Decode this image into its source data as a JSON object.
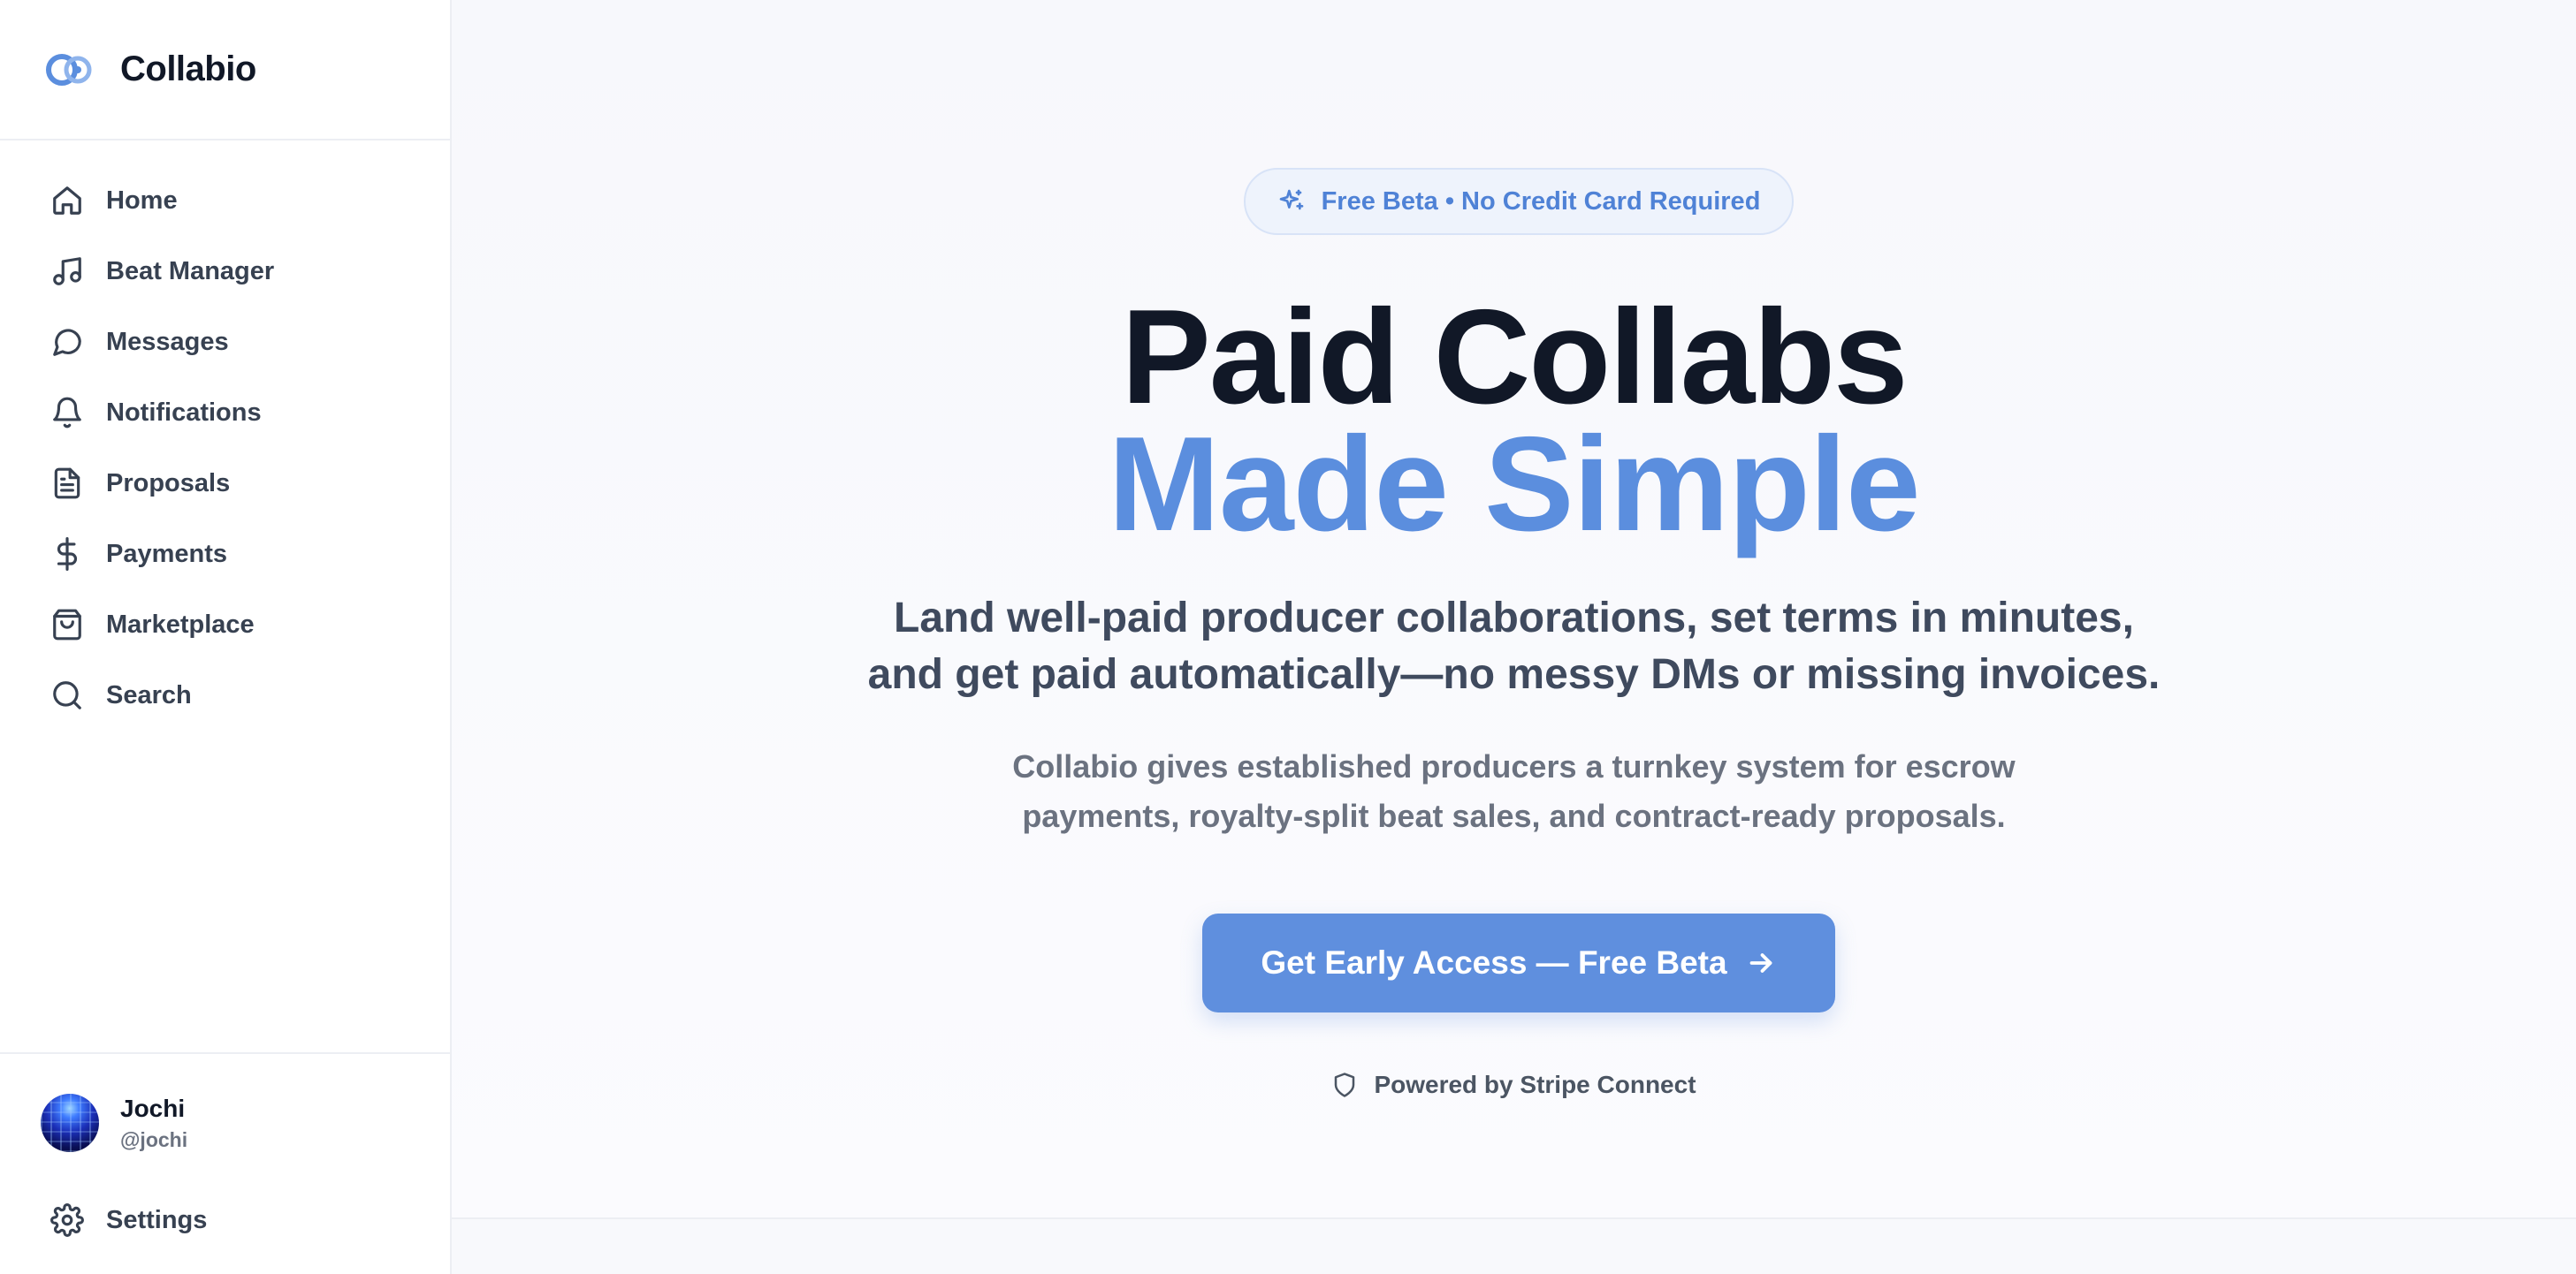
{
  "brand": {
    "name": "Collabio",
    "accent": "#5b8ede"
  },
  "sidebar": {
    "items": [
      {
        "label": "Home",
        "icon": "home-icon"
      },
      {
        "label": "Beat Manager",
        "icon": "music-note-icon"
      },
      {
        "label": "Messages",
        "icon": "message-circle-icon"
      },
      {
        "label": "Notifications",
        "icon": "bell-icon"
      },
      {
        "label": "Proposals",
        "icon": "document-icon"
      },
      {
        "label": "Payments",
        "icon": "dollar-icon"
      },
      {
        "label": "Marketplace",
        "icon": "shopping-bag-icon"
      },
      {
        "label": "Search",
        "icon": "search-icon"
      }
    ],
    "user": {
      "name": "Jochi",
      "handle": "@jochi"
    },
    "settings_label": "Settings"
  },
  "hero": {
    "badge": "Free Beta • No Credit Card Required",
    "headline_line1": "Paid Collabs",
    "headline_line2": "Made Simple",
    "subheadline_line1": "Land well-paid producer collaborations, set terms in minutes,",
    "subheadline_line2": "and get paid automatically—no messy DMs or missing invoices.",
    "description_line1": "Collabio gives established producers a turnkey system for escrow",
    "description_line2": "payments, royalty-split beat sales, and contract-ready proposals.",
    "cta_label": "Get Early Access — Free Beta",
    "powered_by": "Powered by Stripe Connect"
  },
  "colors": {
    "headline": "#111827",
    "headline_accent": "#5b8ede",
    "cta_background": "#5f8fde",
    "badge_background": "#eef3fc"
  }
}
